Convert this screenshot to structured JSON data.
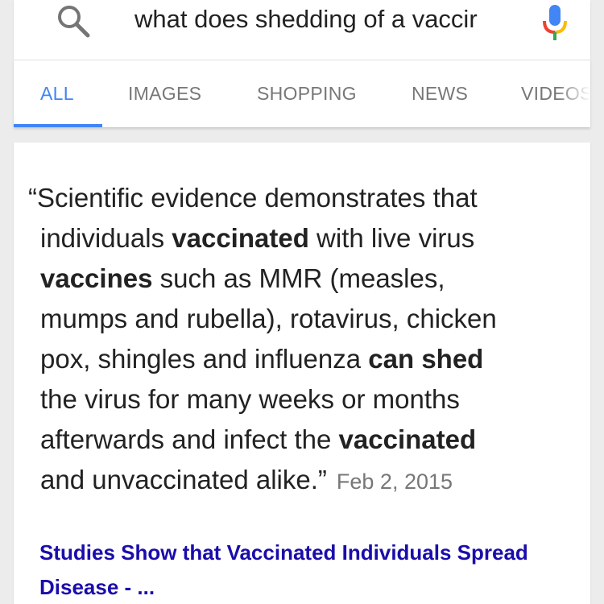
{
  "search": {
    "query": "what does shedding of a vaccir",
    "icon": "search-icon",
    "mic_icon": "mic-icon",
    "colors": {
      "mic_blue": "#4285f4",
      "mic_red": "#ea4335",
      "mic_yellow": "#fbbc05",
      "mic_green": "#34a853"
    }
  },
  "tabs": [
    {
      "label": "ALL",
      "active": true
    },
    {
      "label": "IMAGES",
      "active": false
    },
    {
      "label": "SHOPPING",
      "active": false
    },
    {
      "label": "NEWS",
      "active": false
    },
    {
      "label": "VIDEOS",
      "active": false
    }
  ],
  "snippet": {
    "lines": [
      [
        {
          "t": "“Scientific evidence demonstrates that",
          "b": false
        }
      ],
      [
        {
          "t": "individuals ",
          "b": false
        },
        {
          "t": "vaccinated",
          "b": true
        },
        {
          "t": " with live virus",
          "b": false
        }
      ],
      [
        {
          "t": "vaccines",
          "b": true
        },
        {
          "t": " such as MMR (measles,",
          "b": false
        }
      ],
      [
        {
          "t": "mumps and rubella), rotavirus, chicken",
          "b": false
        }
      ],
      [
        {
          "t": "pox, shingles and influenza ",
          "b": false
        },
        {
          "t": "can shed",
          "b": true
        }
      ],
      [
        {
          "t": "the virus for many weeks or months",
          "b": false
        }
      ],
      [
        {
          "t": "afterwards and infect the ",
          "b": false
        },
        {
          "t": "vaccinated",
          "b": true
        }
      ],
      [
        {
          "t": "and unvaccinated alike.”",
          "b": false
        }
      ]
    ],
    "date": "Feb 2, 2015"
  },
  "result": {
    "title_line1": "Studies Show that Vaccinated Individuals Spread",
    "title_line2": "Disease - ..."
  },
  "colors": {
    "accent": "#4285f4",
    "link": "#1a0dab",
    "background": "#ececec"
  }
}
